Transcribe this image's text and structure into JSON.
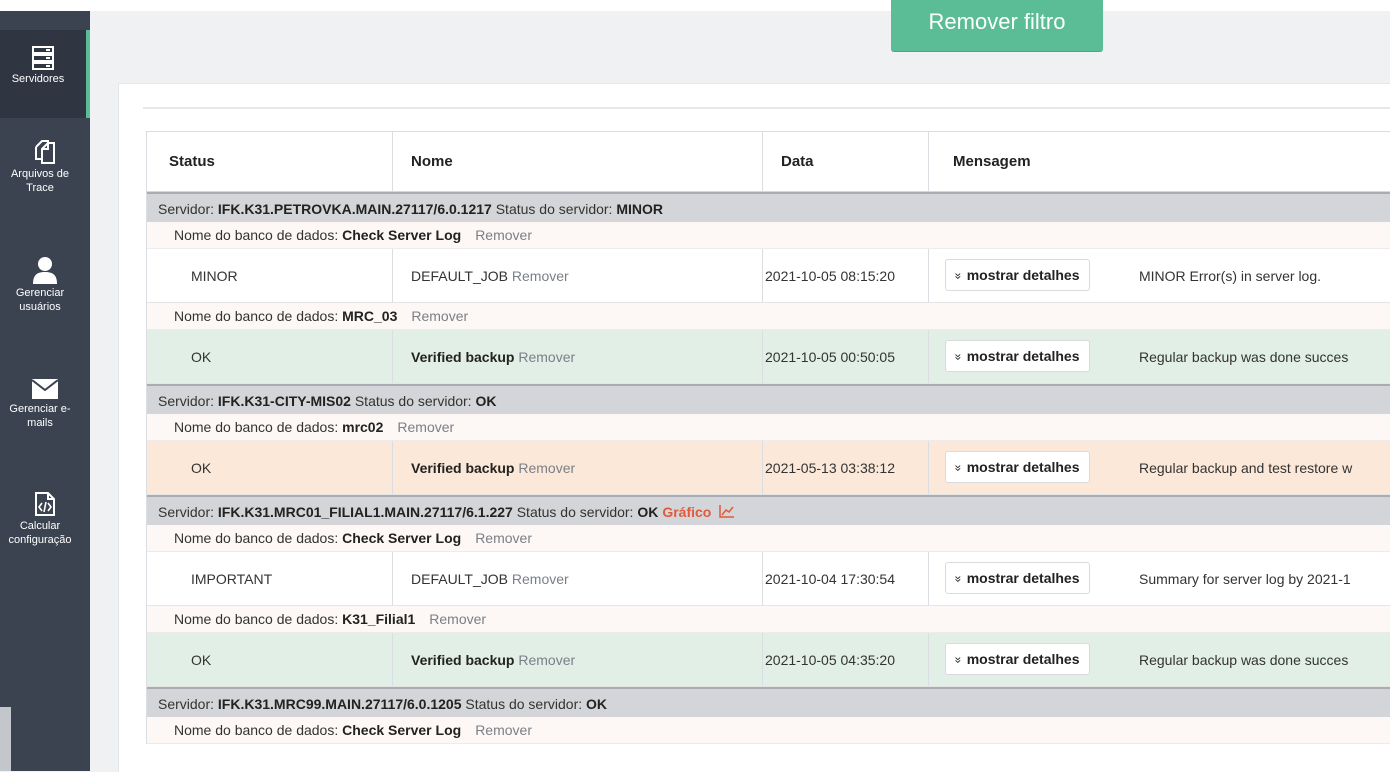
{
  "sidebar": {
    "items": [
      {
        "label": "Servidores",
        "icon": "server-icon",
        "active": true
      },
      {
        "label": "Arquivos de\nTrace",
        "icon": "files-icon",
        "active": false
      },
      {
        "label": "Gerenciar\nusuários",
        "icon": "user-icon",
        "active": false
      },
      {
        "label": "Gerenciar e-\nmails",
        "icon": "envelope-icon",
        "active": false
      },
      {
        "label": "Calcular\nconfiguração",
        "icon": "code-file-icon",
        "active": false
      }
    ]
  },
  "filter_button": {
    "label": "Remover filtro"
  },
  "table": {
    "headers": [
      "Status",
      "Nome",
      "Data",
      "Mensagem"
    ],
    "labels": {
      "server_prefix": "Servidor: ",
      "server_status_prefix": "Status do servidor: ",
      "db_prefix": "Nome do banco de dados: ",
      "remove": "Remover",
      "details": "mostrar detalhes",
      "chart_link": "Gráfico"
    },
    "servers": [
      {
        "name": "IFK.K31.PETROVKA.MAIN.27117/6.0.1217",
        "status": "MINOR",
        "databases": [
          {
            "name": "Check Server Log",
            "job": {
              "status": "MINOR",
              "name": "DEFAULT_JOB",
              "bold": false,
              "date": "2021-10-05 08:15:20",
              "message": "MINOR Error(s) in server log.",
              "color": "white"
            }
          },
          {
            "name": "MRC_03",
            "job": {
              "status": "OK",
              "name": "Verified backup",
              "bold": true,
              "date": "2021-10-05 00:50:05",
              "message": "Regular backup was done succes",
              "color": "green"
            }
          }
        ]
      },
      {
        "name": "IFK.K31-CITY-MIS02",
        "status": "OK",
        "databases": [
          {
            "name": "mrc02",
            "job": {
              "status": "OK",
              "name": "Verified backup",
              "bold": true,
              "date": "2021-05-13 03:38:12",
              "message": "Regular backup and test restore w",
              "color": "peach"
            }
          }
        ]
      },
      {
        "name": "IFK.K31.MRC01_FILIAL1.MAIN.27117/6.1.227",
        "status": "OK",
        "chart": true,
        "databases": [
          {
            "name": "Check Server Log",
            "job": {
              "status": "IMPORTANT",
              "name": "DEFAULT_JOB",
              "bold": false,
              "date": "2021-10-04 17:30:54",
              "message": "Summary for server log by 2021-1",
              "color": "white"
            }
          },
          {
            "name": "K31_Filial1",
            "job": {
              "status": "OK",
              "name": "Verified backup",
              "bold": true,
              "date": "2021-10-05 04:35:20",
              "message": "Regular backup was done succes",
              "color": "green"
            }
          }
        ]
      },
      {
        "name": "IFK.K31.MRC99.MAIN.27117/6.0.1205",
        "status": "OK",
        "databases": [
          {
            "name": "Check Server Log"
          }
        ]
      }
    ]
  },
  "colors": {
    "accent": "#5bbd95",
    "sidebar": "#3b4351",
    "chart_link": "#e05a3c"
  }
}
